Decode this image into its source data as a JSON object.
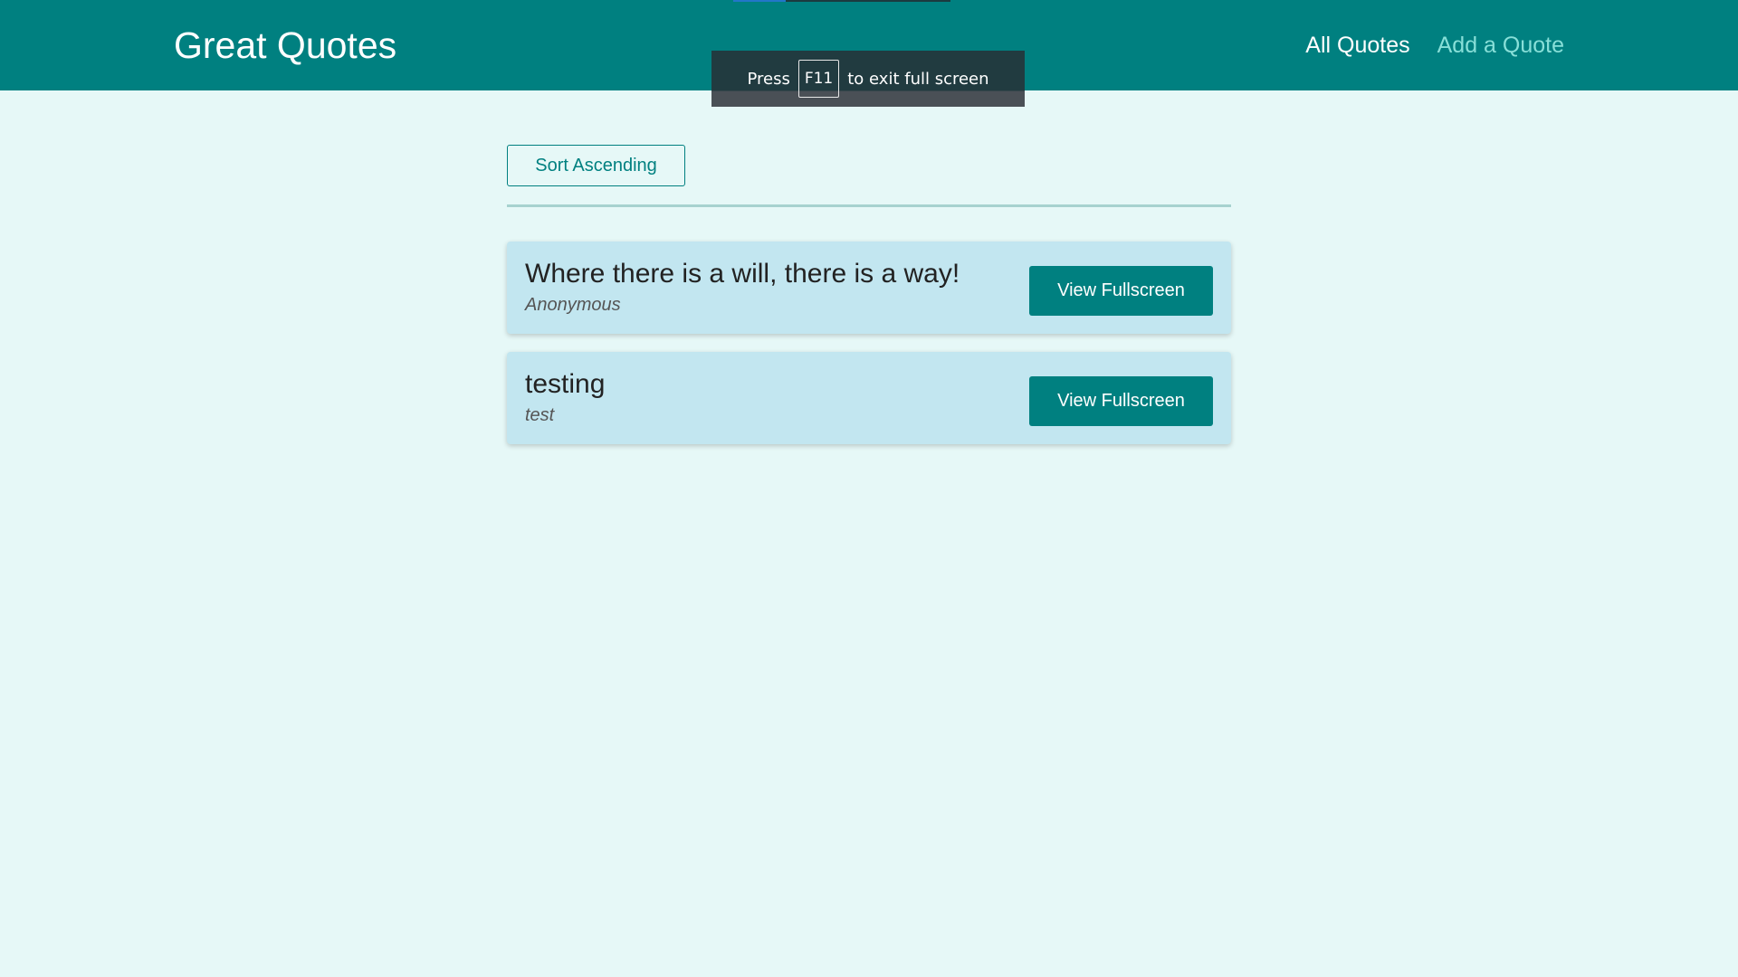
{
  "header": {
    "logo": "Great Quotes",
    "nav": [
      {
        "label": "All Quotes",
        "active": true
      },
      {
        "label": "Add a Quote",
        "active": false
      }
    ],
    "background_color": "#008080"
  },
  "fullscreen_notice": {
    "prefix": "Press",
    "key": "F11",
    "suffix": "to exit full screen"
  },
  "main": {
    "sort_label": "Sort Ascending",
    "quotes": [
      {
        "text": "Where there is a will, there is a way!",
        "author": "Anonymous",
        "action_label": "View Fullscreen"
      },
      {
        "text": "testing",
        "author": "test",
        "action_label": "View Fullscreen"
      }
    ]
  },
  "colors": {
    "page_background": "#e6f8f7",
    "card_background": "#c2e6f0",
    "accent": "#008080",
    "nav_inactive": "#88dfd8"
  }
}
